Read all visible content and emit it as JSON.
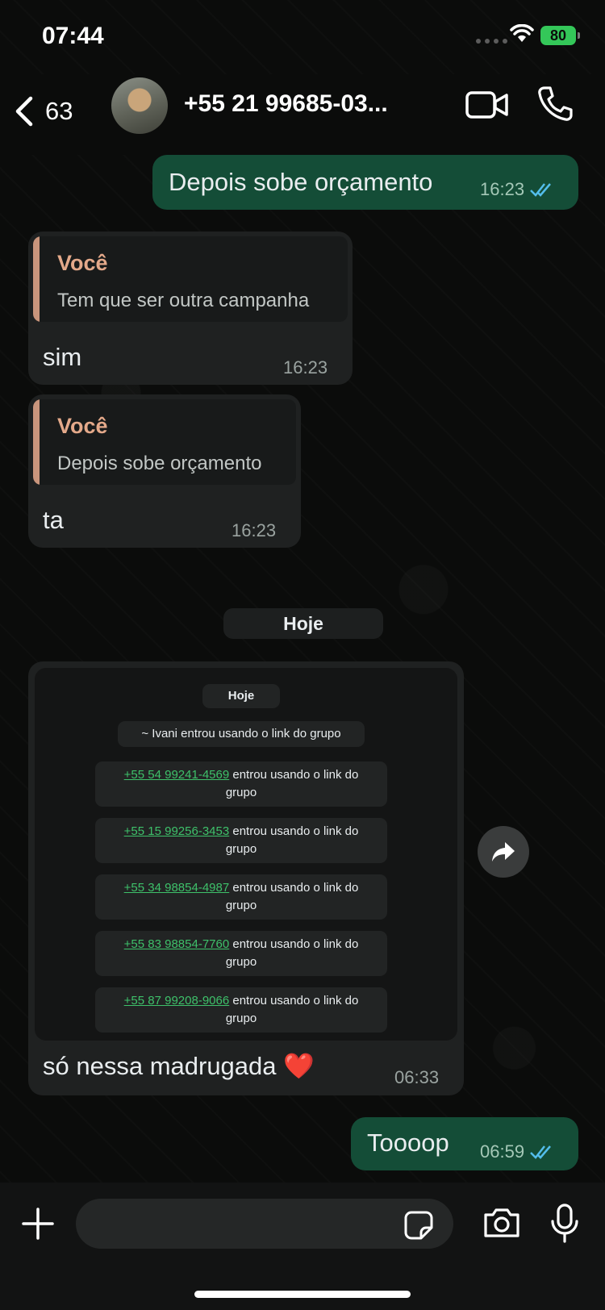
{
  "status_bar": {
    "time": "07:44",
    "battery": "80"
  },
  "header": {
    "back_count": "63",
    "contact_name": "+55 21 99685-03..."
  },
  "messages": [
    {
      "type": "outgoing",
      "text": "Depois sobe orçamento",
      "time": "16:23",
      "read": true
    },
    {
      "type": "incoming",
      "quote_author": "Você",
      "quote_text": "Tem que ser outra campanha",
      "text": "sim",
      "time": "16:23"
    },
    {
      "type": "incoming",
      "quote_author": "Você",
      "quote_text": "Depois sobe orçamento",
      "text": "ta",
      "time": "16:23"
    },
    {
      "type": "date",
      "text": "Hoje"
    },
    {
      "type": "incoming_image",
      "caption": "só nessa madrugada",
      "emoji": "❤️",
      "time": "06:33"
    },
    {
      "type": "outgoing",
      "text": "Toooop",
      "time": "06:59",
      "read": true
    }
  ],
  "screenshot": {
    "date": "Hoje",
    "system": "~ Ivani entrou usando o link do grupo",
    "joined_suffix": "entrou usando o link do",
    "joined_suffix2": "grupo",
    "numbers": [
      "+55 54 99241-4569",
      "+55 15 99256-3453",
      "+55 34 98854-4987",
      "+55 83 98854-7760",
      "+55 87 99208-9066"
    ]
  },
  "colors": {
    "outgoing_bubble": "#144d37",
    "incoming_bubble": "#1f2121",
    "read_ticks": "#53bdeb",
    "quote_accent": "#e4a98a",
    "link_green": "#3ec16a"
  }
}
